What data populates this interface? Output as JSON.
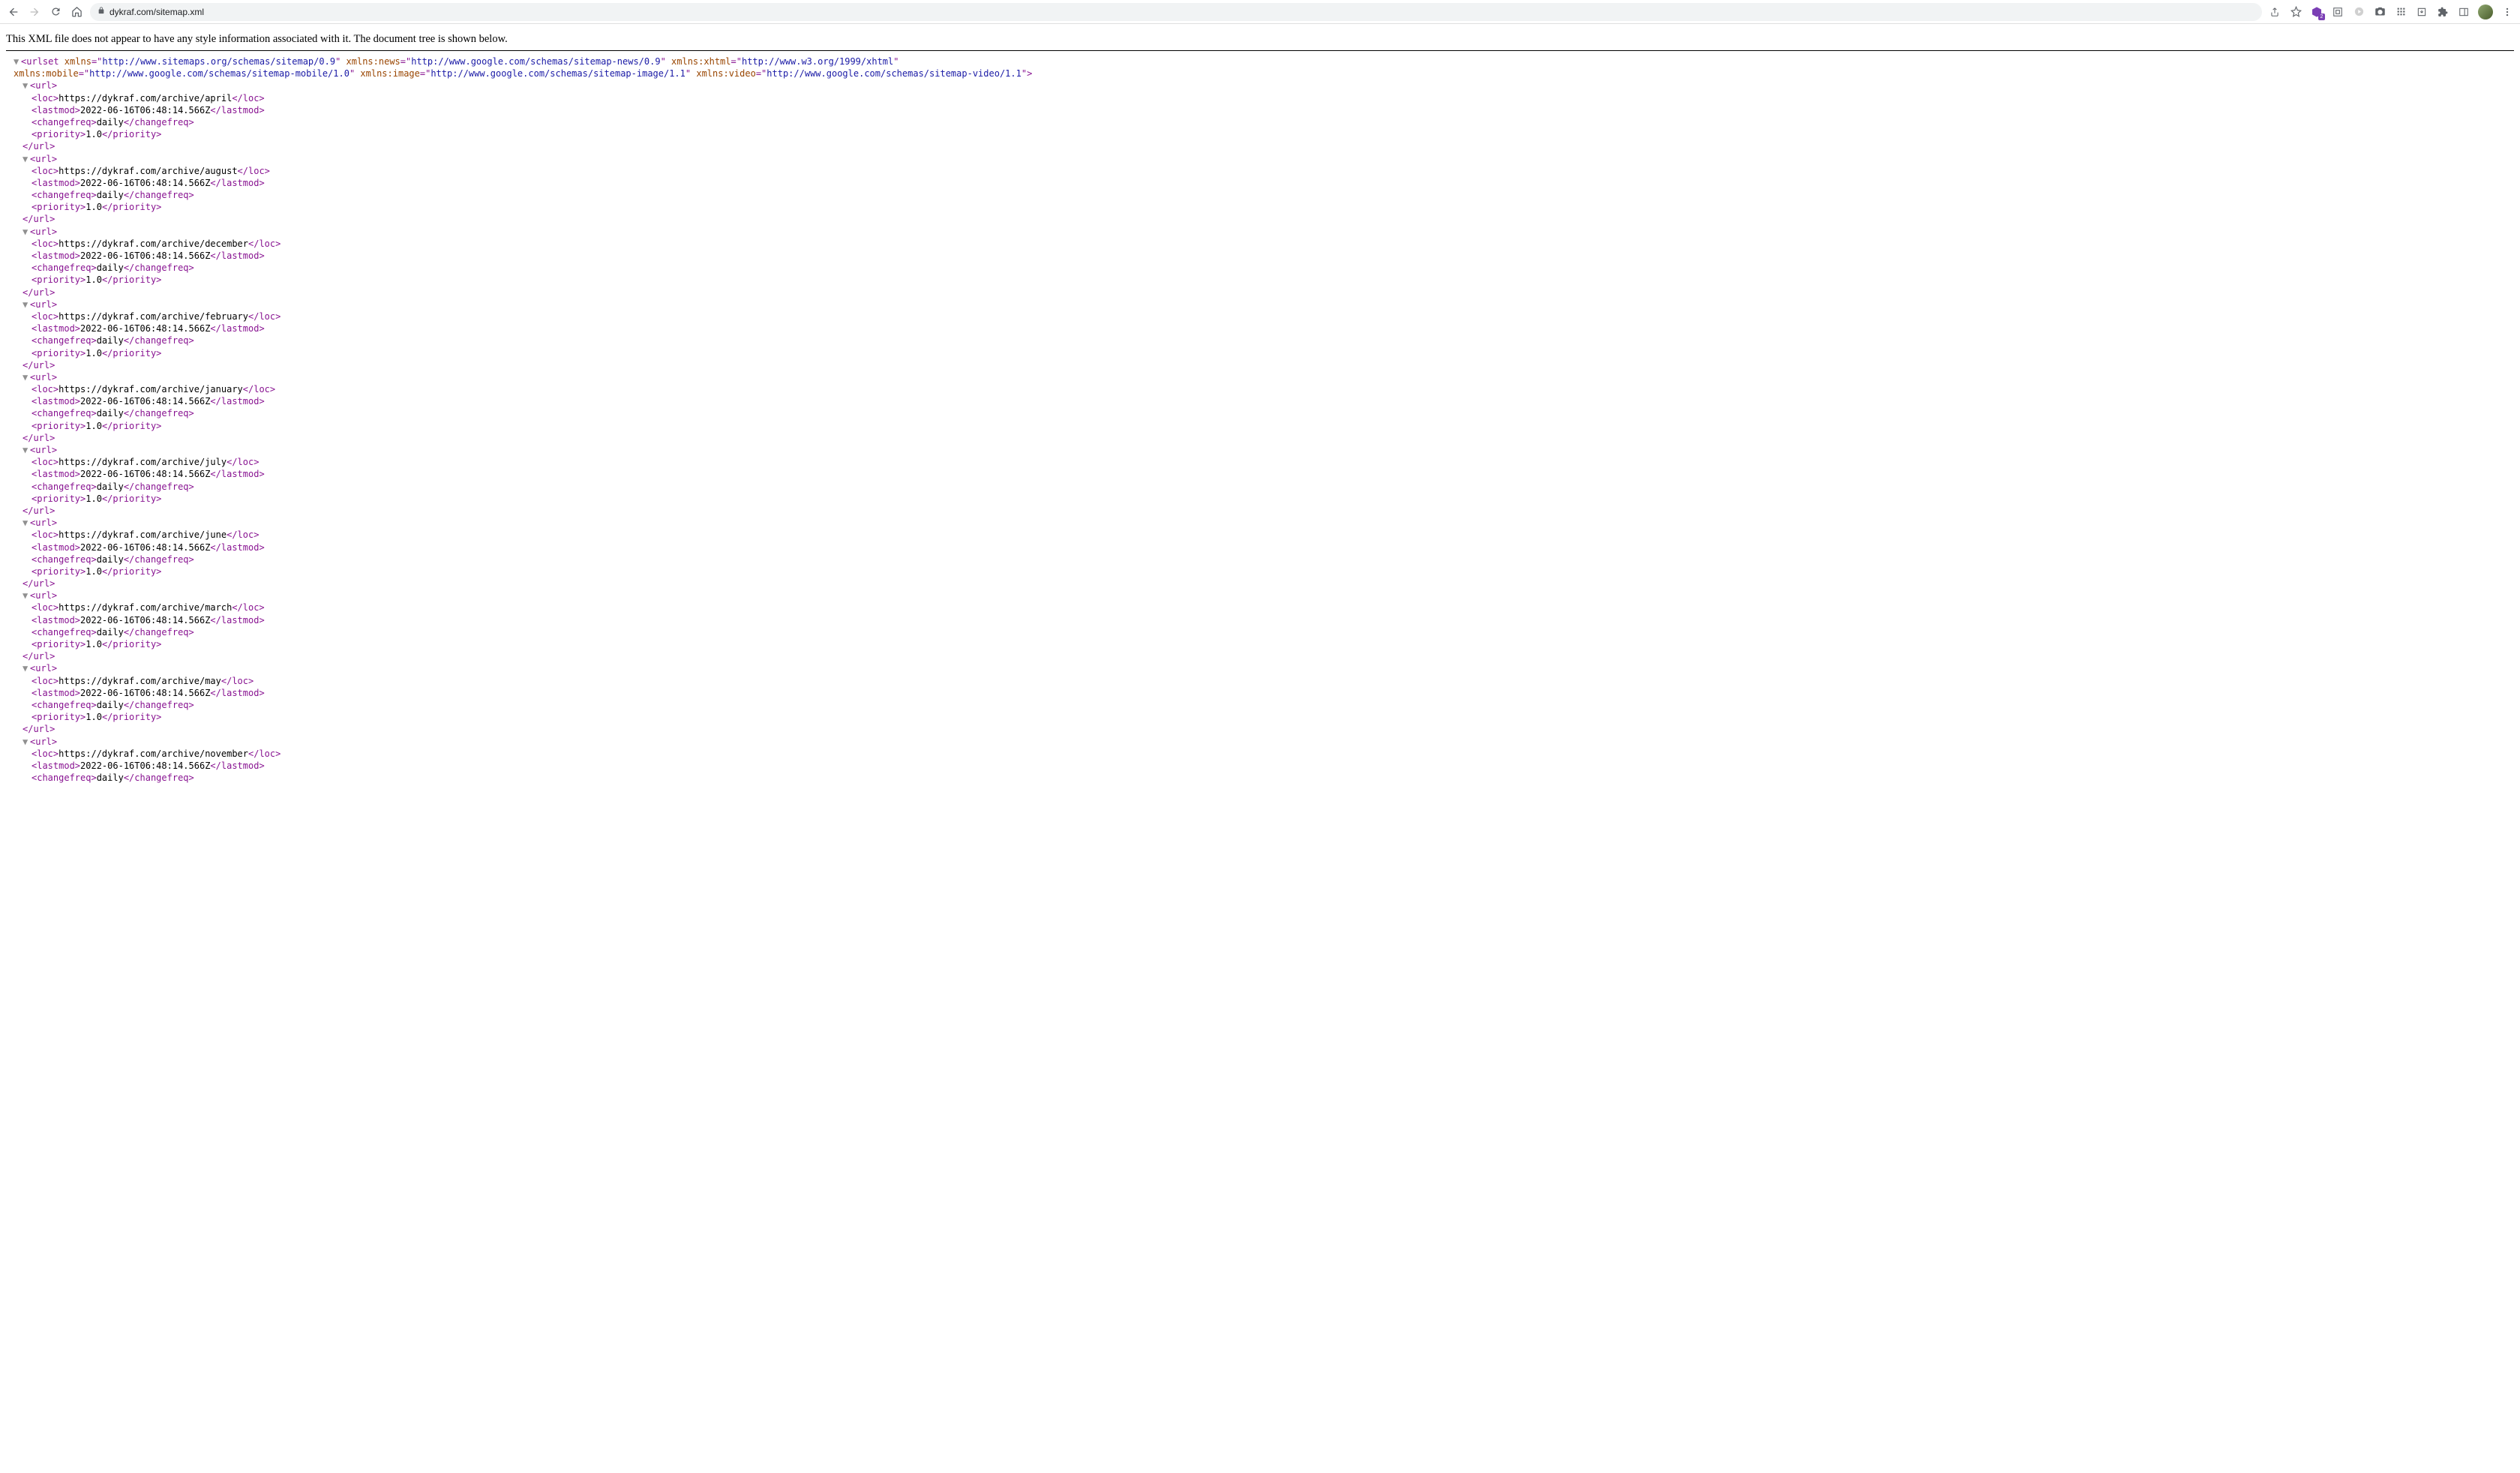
{
  "toolbar": {
    "url": "dykraf.com/sitemap.xml",
    "ext_badge": "2"
  },
  "message": "This XML file does not appear to have any style information associated with it. The document tree is shown below.",
  "root": {
    "tag": "urlset",
    "attrs": [
      {
        "name": "xmlns",
        "value": "http://www.sitemaps.org/schemas/sitemap/0.9"
      },
      {
        "name": "xmlns:news",
        "value": "http://www.google.com/schemas/sitemap-news/0.9"
      },
      {
        "name": "xmlns:xhtml",
        "value": "http://www.w3.org/1999/xhtml"
      },
      {
        "name": "xmlns:mobile",
        "value": "http://www.google.com/schemas/sitemap-mobile/1.0"
      },
      {
        "name": "xmlns:image",
        "value": "http://www.google.com/schemas/sitemap-image/1.1"
      },
      {
        "name": "xmlns:video",
        "value": "http://www.google.com/schemas/sitemap-video/1.1"
      }
    ]
  },
  "common": {
    "lastmod": "2022-06-16T06:48:14.566Z",
    "changefreq": "daily",
    "priority": "1.0"
  },
  "urls": [
    {
      "loc": "https://dykraf.com/archive/april",
      "complete": true
    },
    {
      "loc": "https://dykraf.com/archive/august",
      "complete": true
    },
    {
      "loc": "https://dykraf.com/archive/december",
      "complete": true
    },
    {
      "loc": "https://dykraf.com/archive/february",
      "complete": true
    },
    {
      "loc": "https://dykraf.com/archive/january",
      "complete": true
    },
    {
      "loc": "https://dykraf.com/archive/july",
      "complete": true
    },
    {
      "loc": "https://dykraf.com/archive/june",
      "complete": true
    },
    {
      "loc": "https://dykraf.com/archive/march",
      "complete": true
    },
    {
      "loc": "https://dykraf.com/archive/may",
      "complete": true
    },
    {
      "loc": "https://dykraf.com/archive/november",
      "complete": false
    }
  ]
}
